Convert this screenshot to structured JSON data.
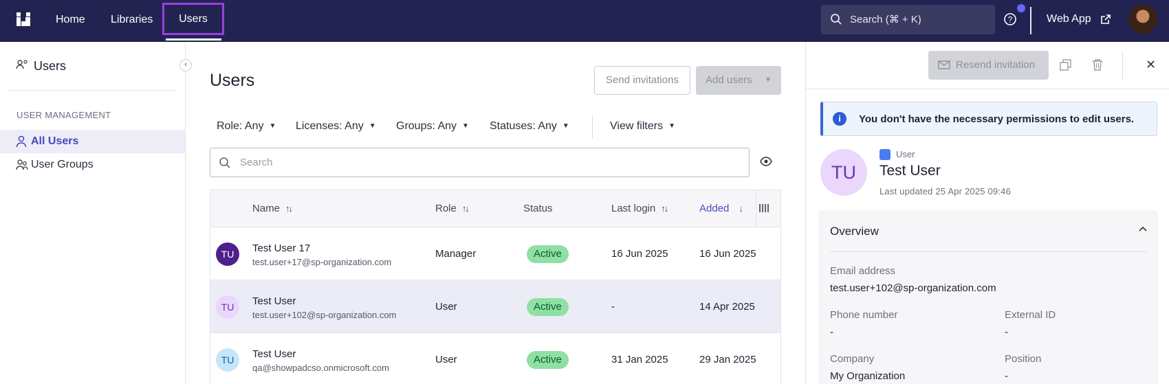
{
  "nav": {
    "home": "Home",
    "libraries": "Libraries",
    "users": "Users",
    "search_placeholder": "Search (⌘ + K)",
    "web_app": "Web App"
  },
  "sidebar": {
    "title": "Users",
    "section": "USER MANAGEMENT",
    "items": [
      {
        "label": "All Users",
        "active": true
      },
      {
        "label": "User Groups",
        "active": false
      }
    ]
  },
  "main": {
    "title": "Users",
    "send_invitations": "Send invitations",
    "add_users": "Add users",
    "filters": {
      "role": "Role: Any",
      "licenses": "Licenses: Any",
      "groups": "Groups: Any",
      "statuses": "Statuses: Any",
      "view": "View filters"
    },
    "search_placeholder": "Search"
  },
  "table": {
    "columns": {
      "name": "Name",
      "role": "Role",
      "status": "Status",
      "last_login": "Last login",
      "added": "Added"
    },
    "rows": [
      {
        "initials": "TU",
        "name": "Test User 17",
        "email": "test.user+17@sp-organization.com",
        "role": "Manager",
        "status": "Active",
        "last_login": "16 Jun 2025",
        "added": "16 Jun 2025"
      },
      {
        "initials": "TU",
        "name": "Test User",
        "email": "test.user+102@sp-organization.com",
        "role": "User",
        "status": "Active",
        "last_login": "-",
        "added": "14 Apr 2025"
      },
      {
        "initials": "TU",
        "name": "Test User",
        "email": "qa@showpadcso.onmicrosoft.com",
        "role": "User",
        "status": "Active",
        "last_login": "31 Jan 2025",
        "added": "29 Jan 2025"
      }
    ]
  },
  "panel": {
    "resend": "Resend invitation",
    "notice": "You don't have the necessary permissions to edit users.",
    "initials": "TU",
    "type": "User",
    "name": "Test User",
    "updated": "Last updated 25 Apr 2025 09:46",
    "overview": {
      "title": "Overview",
      "email_label": "Email address",
      "email": "test.user+102@sp-organization.com",
      "phone_label": "Phone number",
      "phone": "-",
      "external_id_label": "External ID",
      "external_id": "-",
      "company_label": "Company",
      "company": "My Organization",
      "position_label": "Position",
      "position": "-"
    }
  },
  "colors": {
    "topbar": "#232352",
    "accent": "#4747b9",
    "highlight": "#9b3fe0",
    "active_badge": "#8ee0a3"
  }
}
